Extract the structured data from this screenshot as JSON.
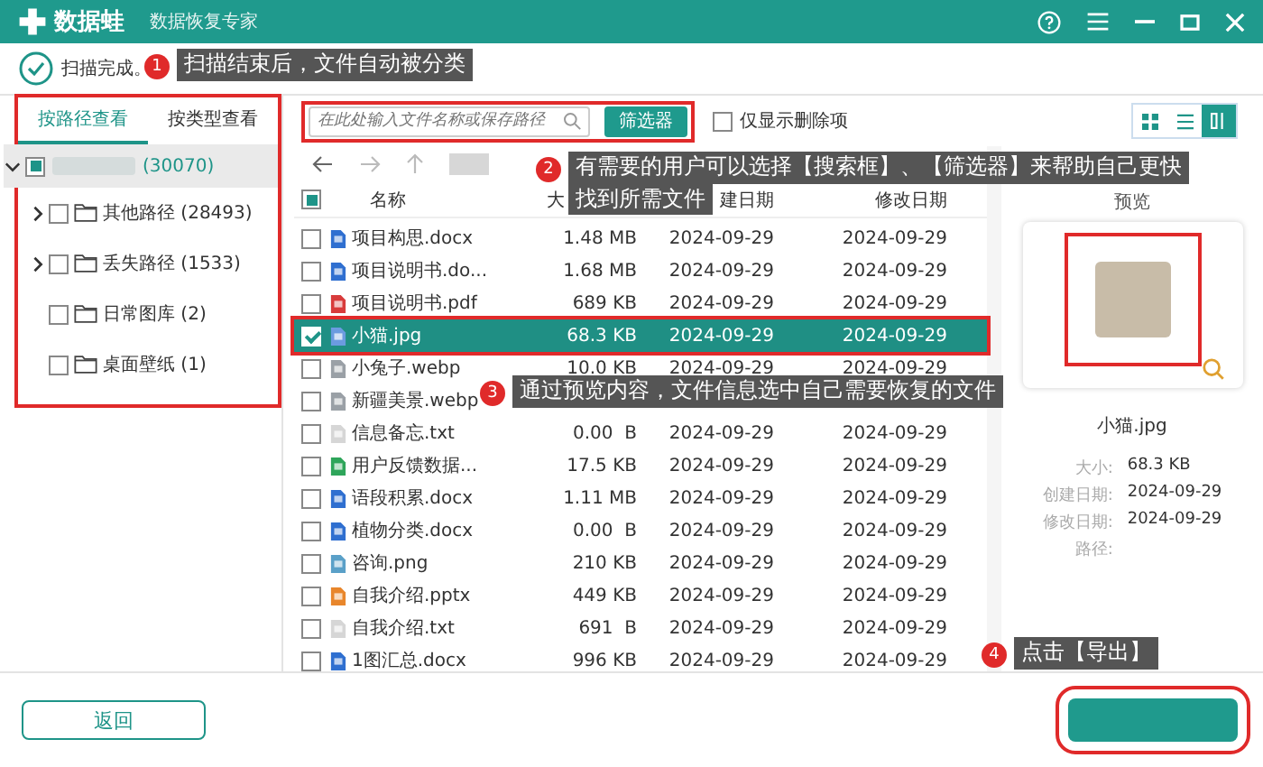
{
  "app": {
    "logo": "数据蛙",
    "subtitle": "数据恢复专家"
  },
  "status": "扫描完成。",
  "view_tabs": [
    {
      "label": "按路径查看",
      "selected": true
    },
    {
      "label": "按类型查看",
      "selected": false
    }
  ],
  "tree": {
    "label": "(30070)",
    "partial": true,
    "expanded": true,
    "children": [
      {
        "label": "其他路径 (28493)",
        "checked": false,
        "expandable": true
      },
      {
        "label": "丢失路径 (1533)",
        "checked": false,
        "expandable": true
      },
      {
        "label": "日常图库 (2)",
        "checked": false,
        "expandable": false
      },
      {
        "label": "桌面壁纸 (1)",
        "checked": false,
        "expandable": false
      }
    ]
  },
  "search": {
    "placeholder": "在此处输入文件名称或保存路径"
  },
  "filter_button": "筛选器",
  "deleted_only": {
    "label": "仅显示删除项",
    "checked": false
  },
  "view_modes": [
    {
      "kind": "grid",
      "selected": false
    },
    {
      "kind": "list",
      "selected": false
    },
    {
      "kind": "preview",
      "selected": true
    }
  ],
  "table": {
    "header_partial": true,
    "columns": [
      "名称",
      "大",
      "建日期",
      "修改日期"
    ],
    "rows": [
      {
        "kind": "doc",
        "name": "项目构思.docx",
        "size": "1.48 MB",
        "created": "2024-09-29",
        "modified": "2024-09-29",
        "checked": false,
        "selected": false
      },
      {
        "kind": "doc",
        "name": "项目说明书.do...",
        "size": "1.68 MB",
        "created": "2024-09-29",
        "modified": "2024-09-29",
        "checked": false,
        "selected": false
      },
      {
        "kind": "pdf",
        "name": "项目说明书.pdf",
        "size": "689 KB",
        "created": "2024-09-29",
        "modified": "2024-09-29",
        "checked": false,
        "selected": false
      },
      {
        "kind": "image",
        "name": "小猫.jpg",
        "size": "68.3 KB",
        "created": "2024-09-29",
        "modified": "2024-09-29",
        "checked": true,
        "selected": true
      },
      {
        "kind": "webp",
        "name": "小兔子.webp",
        "size": "10.0 KB",
        "created": "2024-09-29",
        "modified": "2024-09-29",
        "checked": false,
        "selected": false
      },
      {
        "kind": "webp",
        "name": "新疆美景.webp",
        "checked": false,
        "selected": false
      },
      {
        "kind": "txt",
        "name": "信息备忘.txt",
        "size": "0.00  B",
        "created": "2024-09-29",
        "modified": "2024-09-29",
        "checked": false,
        "selected": false
      },
      {
        "kind": "sheet",
        "name": "用户反馈数据...",
        "size": "17.5 KB",
        "created": "2024-09-29",
        "modified": "2024-09-29",
        "checked": false,
        "selected": false
      },
      {
        "kind": "doc",
        "name": "语段积累.docx",
        "size": "1.11 MB",
        "created": "2024-09-29",
        "modified": "2024-09-29",
        "checked": false,
        "selected": false
      },
      {
        "kind": "doc",
        "name": "植物分类.docx",
        "size": "0.00  B",
        "created": "2024-09-29",
        "modified": "2024-09-29",
        "checked": false,
        "selected": false
      },
      {
        "kind": "png",
        "name": "咨询.png",
        "size": "210 KB",
        "created": "2024-09-29",
        "modified": "2024-09-29",
        "checked": false,
        "selected": false
      },
      {
        "kind": "ppt",
        "name": "自我介绍.pptx",
        "size": "449 KB",
        "created": "2024-09-29",
        "modified": "2024-09-29",
        "checked": false,
        "selected": false
      },
      {
        "kind": "txt",
        "name": "自我介绍.txt",
        "size": "691  B",
        "created": "2024-09-29",
        "modified": "2024-09-29",
        "checked": false,
        "selected": false
      },
      {
        "kind": "doc",
        "name": "1图汇总.docx",
        "size": "996 KB",
        "created": "2024-09-29",
        "modified": "2024-09-29",
        "checked": false,
        "selected": false
      }
    ]
  },
  "preview": {
    "title": "预览",
    "filename": "小猫.jpg",
    "details": [
      {
        "label": "大小:",
        "value": "68.3 KB"
      },
      {
        "label": "创建日期:",
        "value": "2024-09-29"
      },
      {
        "label": "修改日期:",
        "value": "2024-09-29"
      },
      {
        "label": "路径:"
      }
    ]
  },
  "back_button": "返回",
  "callouts": [
    {
      "number": "1",
      "lines": [
        "扫描结束后，文件自动被分类"
      ]
    },
    {
      "number": "2",
      "lines": [
        "有需要的用户可以选择【搜索框】、【筛选器】来帮助自己更快",
        "找到所需文件"
      ]
    },
    {
      "number": "3",
      "lines": [
        "通过预览内容，文件信息选中自己需要恢复的文件"
      ]
    },
    {
      "number": "4",
      "lines": [
        "点击【导出】"
      ]
    }
  ]
}
